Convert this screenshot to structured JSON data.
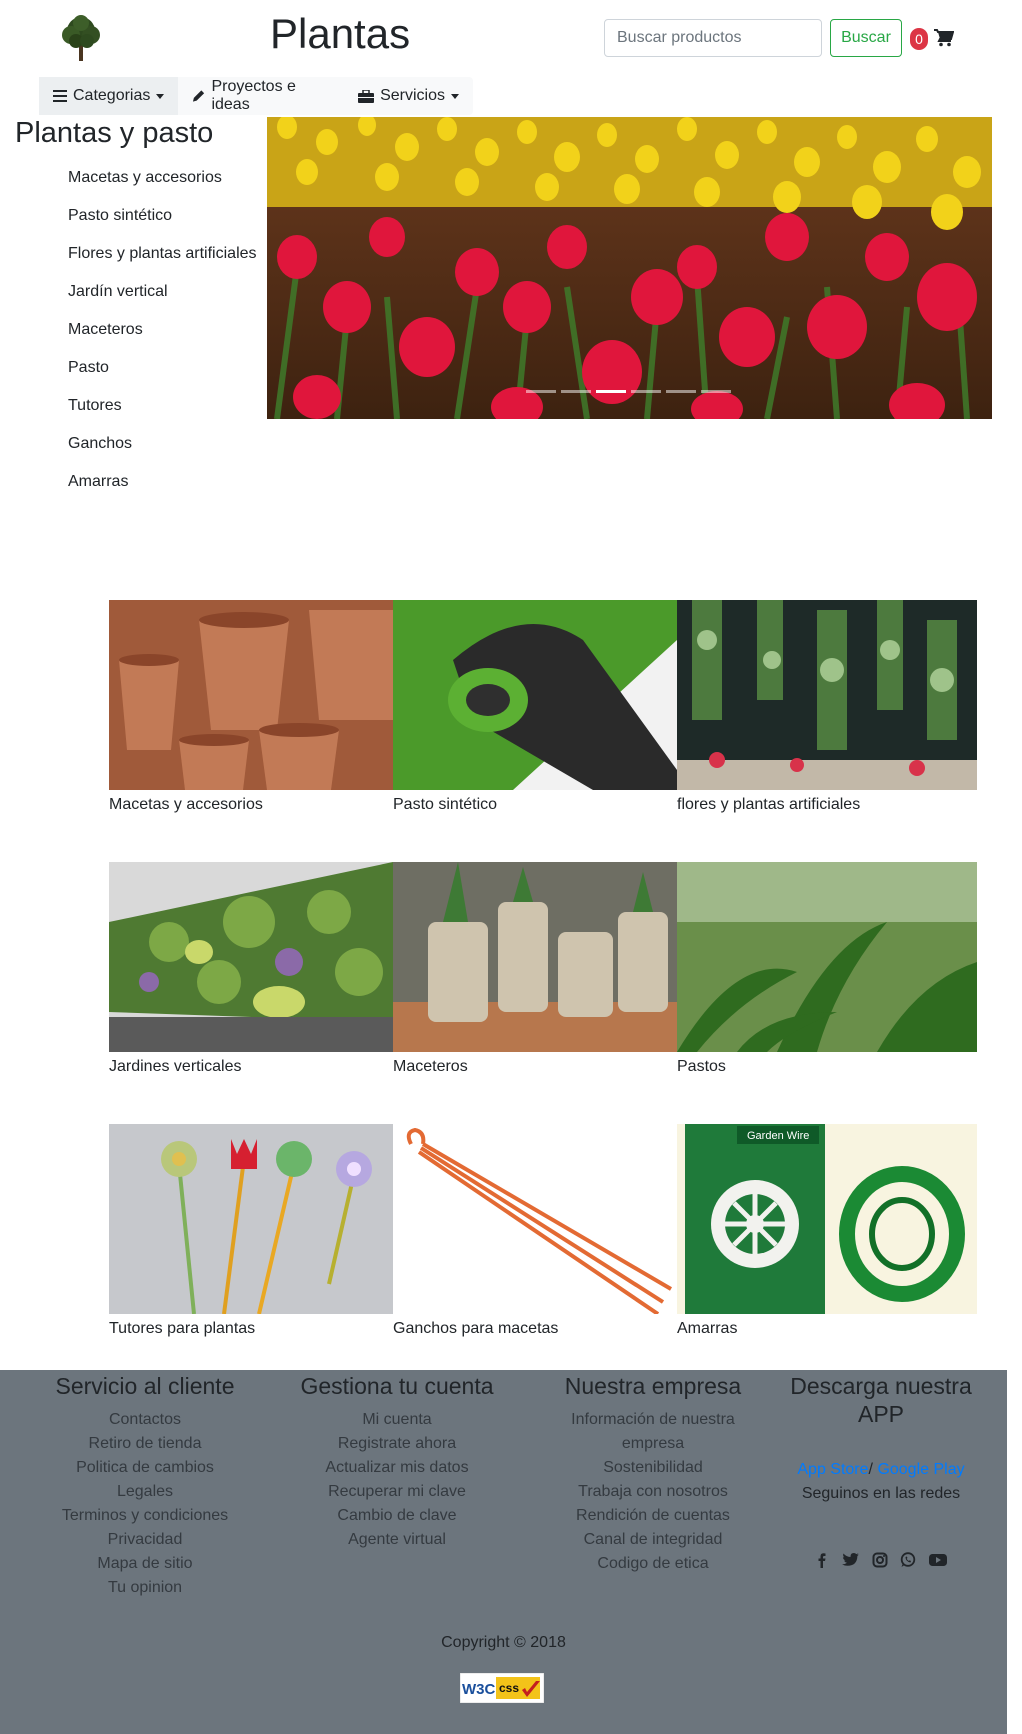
{
  "header": {
    "title": "Plantas",
    "search_placeholder": "Buscar productos",
    "search_button": "Buscar",
    "cart_count": "0"
  },
  "nav": {
    "items": [
      {
        "label": "Categorias",
        "icon": "bars-icon"
      },
      {
        "label": "Proyectos e ideas",
        "icon": "pencil-icon"
      },
      {
        "label": "Servicios",
        "icon": "toolbox-icon"
      }
    ]
  },
  "sidebar": {
    "title": "Plantas y pasto",
    "items": [
      "Macetas y accesorios",
      "Pasto sintético",
      "Flores y plantas artificiales",
      "Jardín vertical",
      "Maceteros",
      "Pasto",
      "Tutores",
      "Ganchos",
      "Amarras"
    ]
  },
  "carousel": {
    "slides": 6,
    "active_index": 2
  },
  "products": [
    "Macetas y accesorios",
    "Pasto sintético",
    "flores y plantas artificiales",
    "Jardines verticales",
    "Maceteros",
    "Pastos",
    "Tutores para plantas",
    "Ganchos para macetas",
    "Amarras"
  ],
  "footer": {
    "col1": {
      "title": "Servicio al cliente",
      "links": [
        "Contactos",
        "Retiro de tienda",
        "Politica de cambios",
        "Legales",
        "Terminos y condiciones",
        "Privacidad",
        "Mapa de sitio",
        "Tu opinion"
      ]
    },
    "col2": {
      "title": "Gestiona tu cuenta",
      "links": [
        "Mi cuenta",
        "Registrate ahora",
        "Actualizar mis datos",
        "Recuperar mi clave",
        "Cambio de clave",
        "Agente virtual"
      ]
    },
    "col3": {
      "title": "Nuestra empresa",
      "links": [
        "Información de nuestra empresa",
        "Sostenibilidad",
        "Trabaja con nosotros",
        "Rendición de cuentas",
        "Canal de integridad",
        "Codigo de etica"
      ]
    },
    "col4": {
      "title": "Descarga nuestra APP",
      "app_store": "App Store",
      "separator": "/",
      "google_play": "Google Play",
      "social_label": "Seguinos en las redes"
    },
    "copyright": "Copyright © 2018",
    "badge_text": "W3C css"
  },
  "colors": {
    "footer_bg": "#6c757d",
    "accent_green": "#28a745",
    "badge_red": "#dc3545",
    "link_blue": "#007bff"
  }
}
